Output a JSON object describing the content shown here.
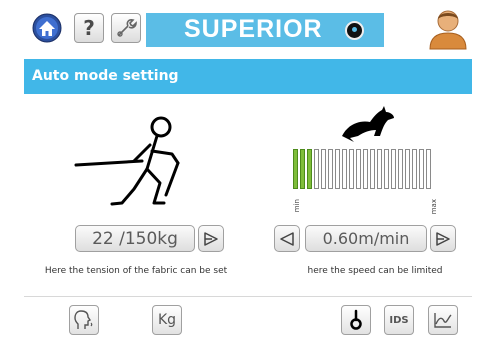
{
  "topbar": {
    "help_label": "?",
    "brand": "SUPERIOR",
    "icons": [
      "home-icon",
      "help-icon",
      "wrench-icon",
      "knob-icon",
      "user-icon"
    ]
  },
  "section": {
    "title": "Auto mode setting"
  },
  "tension": {
    "value_text": "22 /150kg",
    "caption": "Here the tension of the fabric can be set"
  },
  "speed": {
    "value_text": "0.60m/min",
    "caption": "here the speed can be limited",
    "min_label": "min",
    "max_label": "max",
    "level_segments": 3,
    "total_segments": 20
  },
  "bottombar": {
    "kg_label": "Kg",
    "ids_label": "IDS",
    "icons": [
      "face-sound-icon",
      "kg-icon",
      "probe-icon",
      "ids-icon",
      "graph-icon"
    ]
  },
  "colors": {
    "brand_blue": "#5bbde6",
    "header_blue": "#41b7e8",
    "level_green": "#7fbd3a"
  }
}
